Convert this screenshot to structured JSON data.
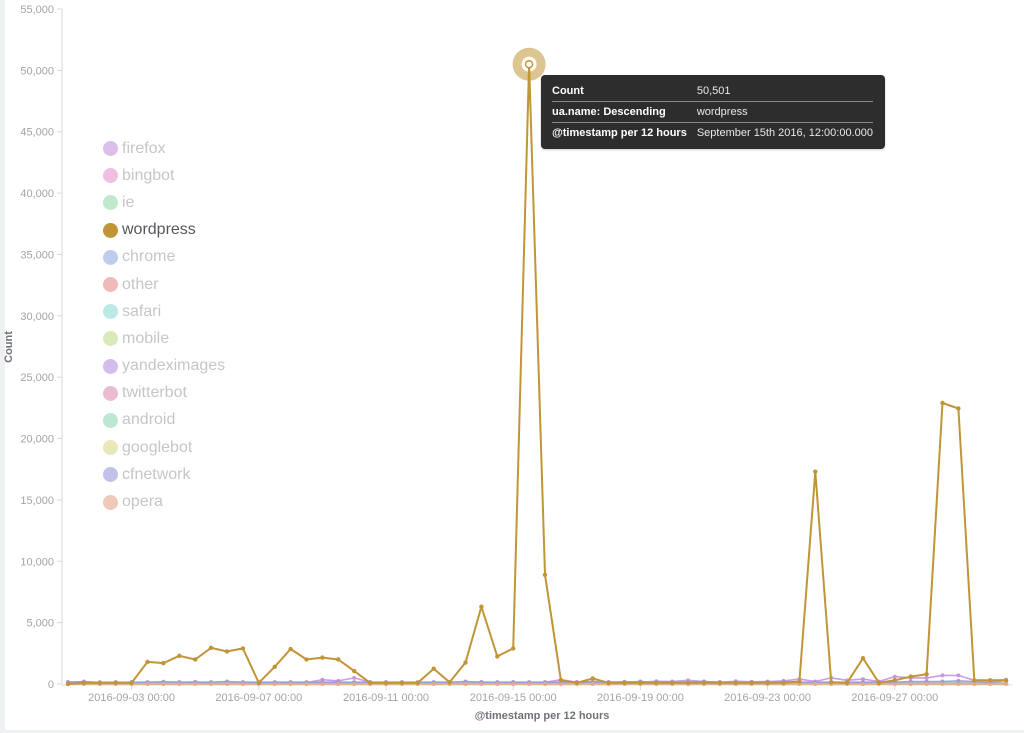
{
  "chart_data": {
    "type": "line",
    "title": "",
    "xlabel": "@timestamp per 12 hours",
    "ylabel": "Count",
    "ylim": [
      0,
      55000
    ],
    "y_ticks": [
      0,
      5000,
      10000,
      15000,
      20000,
      25000,
      30000,
      35000,
      40000,
      45000,
      50000,
      55000
    ],
    "y_tick_labels": [
      "0",
      "5,000",
      "10,000",
      "15,000",
      "20,000",
      "25,000",
      "30,000",
      "35,000",
      "40,000",
      "45,000",
      "50,000",
      "55,000"
    ],
    "x_start": "2016-09-01 00:00",
    "x_interval_hours": 12,
    "x_ticks": [
      "2016-09-03 00:00",
      "2016-09-07 00:00",
      "2016-09-11 00:00",
      "2016-09-15 00:00",
      "2016-09-19 00:00",
      "2016-09-23 00:00",
      "2016-09-27 00:00"
    ],
    "x_tick_indices": [
      4,
      12,
      20,
      28,
      36,
      44,
      52
    ],
    "grid": false,
    "legend_position": "left",
    "highlighted_series": "wordpress",
    "series": [
      {
        "name": "firefox",
        "color": "#c493dd",
        "values": [
          150,
          200,
          120,
          100,
          150,
          120,
          100,
          130,
          160,
          120,
          100,
          130,
          120,
          100,
          130,
          110,
          350,
          250,
          500,
          150,
          120,
          110,
          100,
          120,
          150,
          130,
          150,
          120,
          130,
          120,
          140,
          350,
          150,
          200,
          150,
          180,
          150,
          220,
          200,
          300,
          200,
          150,
          220,
          180,
          200,
          250,
          400,
          200,
          500,
          300,
          400,
          200,
          600,
          500,
          500,
          700,
          700,
          300,
          250,
          350
        ]
      },
      {
        "name": "bingbot",
        "color": "#e195d0",
        "values": [
          100,
          120,
          100,
          100,
          110,
          100,
          100,
          120,
          100,
          100,
          110,
          100,
          100,
          100,
          100,
          120,
          100,
          120,
          100,
          110,
          100,
          100,
          100,
          110,
          100,
          100,
          120,
          100,
          100,
          100,
          100,
          100,
          120,
          100,
          100,
          110,
          100,
          100,
          120,
          100,
          100,
          100,
          100,
          100,
          110,
          100,
          100,
          100,
          120,
          100,
          100,
          100,
          100,
          120,
          100,
          100,
          100,
          120,
          100,
          100
        ]
      },
      {
        "name": "ie",
        "color": "#94dba6",
        "values": [
          80,
          90,
          80,
          80,
          120,
          80,
          80,
          90,
          80,
          100,
          80,
          80,
          80,
          90,
          80,
          80,
          80,
          90,
          80,
          80,
          80,
          90,
          80,
          100,
          80,
          80,
          90,
          80,
          80,
          90,
          80,
          80,
          90,
          80,
          80,
          90,
          80,
          80,
          150,
          150,
          150,
          120,
          100,
          100,
          90,
          80,
          90,
          80,
          100,
          80,
          90,
          80,
          90,
          80,
          80,
          100,
          80,
          80,
          90,
          80
        ]
      },
      {
        "name": "wordpress",
        "color": "#c09537",
        "values": [
          0,
          100,
          100,
          100,
          100,
          1800,
          1700,
          2300,
          2000,
          2950,
          2650,
          2900,
          100,
          1400,
          2850,
          2000,
          2150,
          2000,
          1050,
          100,
          100,
          100,
          100,
          1250,
          150,
          1750,
          6300,
          2250,
          2900,
          50501,
          8900,
          300,
          100,
          450,
          100,
          100,
          100,
          100,
          100,
          100,
          100,
          100,
          100,
          100,
          100,
          100,
          200,
          17300,
          150,
          100,
          2100,
          100,
          300,
          600,
          800,
          22900,
          22450,
          300,
          300,
          300
        ]
      },
      {
        "name": "chrome",
        "color": "#95ace0",
        "values": [
          60,
          60,
          60,
          60,
          60,
          60,
          60,
          60,
          60,
          60,
          60,
          60,
          60,
          60,
          60,
          60,
          60,
          60,
          60,
          60,
          60,
          60,
          60,
          60,
          60,
          60,
          60,
          60,
          60,
          60,
          60,
          60,
          60,
          60,
          60,
          60,
          60,
          60,
          60,
          60,
          60,
          60,
          60,
          60,
          60,
          60,
          60,
          60,
          60,
          60,
          60,
          60,
          60,
          60,
          60,
          60,
          60,
          60,
          60,
          60
        ]
      },
      {
        "name": "other",
        "color": "#e38c8c",
        "values": [
          50,
          50,
          50,
          50,
          50,
          50,
          50,
          50,
          50,
          50,
          50,
          50,
          50,
          50,
          50,
          50,
          50,
          50,
          50,
          50,
          50,
          50,
          50,
          50,
          80,
          50,
          50,
          50,
          50,
          50,
          50,
          50,
          50,
          50,
          50,
          50,
          50,
          50,
          50,
          50,
          50,
          50,
          50,
          50,
          50,
          80,
          50,
          50,
          50,
          50,
          50,
          50,
          50,
          50,
          50,
          50,
          50,
          50,
          50,
          50
        ]
      },
      {
        "name": "safari",
        "color": "#8fdbd6",
        "values": [
          40,
          40,
          40,
          40,
          40,
          40,
          40,
          40,
          40,
          40,
          40,
          40,
          40,
          40,
          40,
          40,
          40,
          40,
          40,
          40,
          40,
          40,
          40,
          40,
          40,
          40,
          40,
          40,
          40,
          40,
          40,
          40,
          40,
          40,
          40,
          40,
          40,
          40,
          40,
          40,
          40,
          40,
          40,
          40,
          40,
          40,
          40,
          40,
          40,
          40,
          40,
          40,
          40,
          40,
          40,
          40,
          40,
          40,
          40,
          40
        ]
      },
      {
        "name": "mobile",
        "color": "#bfda8c",
        "values": [
          30,
          30,
          30,
          30,
          30,
          30,
          30,
          30,
          30,
          30,
          30,
          30,
          30,
          30,
          30,
          30,
          30,
          30,
          30,
          30,
          30,
          30,
          30,
          30,
          30,
          30,
          30,
          30,
          30,
          30,
          30,
          30,
          30,
          30,
          30,
          30,
          30,
          30,
          30,
          30,
          30,
          30,
          30,
          30,
          30,
          30,
          30,
          30,
          30,
          30,
          30,
          30,
          30,
          30,
          30,
          30,
          30,
          30,
          30,
          30
        ]
      },
      {
        "name": "yandeximages",
        "color": "#b890e0",
        "values": [
          20,
          20,
          20,
          20,
          20,
          20,
          20,
          20,
          20,
          20,
          20,
          20,
          20,
          20,
          20,
          20,
          20,
          20,
          20,
          20,
          20,
          20,
          20,
          20,
          20,
          20,
          20,
          20,
          20,
          20,
          20,
          20,
          20,
          20,
          20,
          20,
          20,
          20,
          20,
          20,
          20,
          20,
          20,
          20,
          20,
          20,
          20,
          20,
          20,
          20,
          20,
          20,
          20,
          20,
          20,
          20,
          20,
          20,
          20,
          20
        ]
      },
      {
        "name": "twitterbot",
        "color": "#dd8faf",
        "values": [
          20,
          20,
          20,
          20,
          20,
          20,
          20,
          20,
          20,
          20,
          20,
          20,
          20,
          20,
          20,
          20,
          20,
          20,
          20,
          20,
          20,
          20,
          20,
          20,
          20,
          20,
          20,
          20,
          20,
          20,
          20,
          20,
          20,
          20,
          20,
          20,
          20,
          20,
          20,
          20,
          20,
          20,
          20,
          20,
          20,
          20,
          20,
          20,
          20,
          20,
          20,
          20,
          20,
          20,
          20,
          20,
          20,
          20,
          20,
          20
        ]
      },
      {
        "name": "android",
        "color": "#8fd9b6",
        "values": [
          15,
          15,
          15,
          15,
          15,
          15,
          15,
          15,
          15,
          15,
          15,
          15,
          15,
          15,
          15,
          15,
          15,
          15,
          15,
          15,
          15,
          15,
          15,
          15,
          15,
          15,
          15,
          15,
          15,
          15,
          15,
          15,
          15,
          15,
          15,
          15,
          15,
          15,
          15,
          15,
          15,
          15,
          15,
          15,
          15,
          15,
          15,
          15,
          15,
          15,
          15,
          15,
          15,
          15,
          15,
          15,
          15,
          15,
          15,
          15
        ]
      },
      {
        "name": "googlebot",
        "color": "#d9d98e",
        "values": [
          10,
          10,
          10,
          10,
          10,
          10,
          10,
          10,
          10,
          10,
          10,
          10,
          10,
          10,
          10,
          10,
          10,
          10,
          10,
          10,
          10,
          10,
          10,
          10,
          10,
          10,
          10,
          10,
          10,
          10,
          10,
          10,
          10,
          10,
          10,
          10,
          10,
          10,
          10,
          10,
          10,
          10,
          10,
          10,
          10,
          10,
          10,
          10,
          10,
          10,
          10,
          10,
          10,
          10,
          10,
          10,
          10,
          10,
          10,
          10
        ]
      },
      {
        "name": "cfnetwork",
        "color": "#9898e0",
        "values": [
          150,
          150,
          140,
          150,
          140,
          150,
          180,
          150,
          150,
          150,
          200,
          150,
          150,
          150,
          150,
          150,
          150,
          150,
          150,
          150,
          150,
          150,
          150,
          150,
          150,
          200,
          150,
          150,
          150,
          150,
          150,
          150,
          150,
          150,
          150,
          150,
          200,
          150,
          150,
          150,
          200,
          150,
          150,
          150,
          150,
          200,
          150,
          150,
          150,
          150,
          150,
          150,
          150,
          200,
          200,
          200,
          250,
          200,
          100,
          300
        ]
      },
      {
        "name": "opera",
        "color": "#e3a888",
        "values": [
          10,
          10,
          10,
          10,
          10,
          10,
          10,
          10,
          10,
          10,
          10,
          10,
          10,
          10,
          10,
          10,
          10,
          10,
          10,
          10,
          10,
          10,
          10,
          10,
          10,
          10,
          10,
          10,
          10,
          10,
          10,
          10,
          10,
          10,
          10,
          10,
          10,
          10,
          10,
          10,
          10,
          10,
          10,
          10,
          10,
          10,
          10,
          10,
          10,
          10,
          10,
          10,
          10,
          10,
          10,
          10,
          10,
          10,
          10,
          10
        ]
      }
    ]
  },
  "legend": {
    "items": [
      "firefox",
      "bingbot",
      "ie",
      "wordpress",
      "chrome",
      "other",
      "safari",
      "mobile",
      "yandeximages",
      "twitterbot",
      "android",
      "googlebot",
      "cfnetwork",
      "opera"
    ]
  },
  "tooltip": {
    "rows": [
      {
        "key": "Count",
        "value": "50,501"
      },
      {
        "key": "ua.name: Descending",
        "value": "wordpress"
      },
      {
        "key": "@timestamp per 12 hours",
        "value": "September 15th 2016, 12:00:00.000"
      }
    ],
    "point_index": 29,
    "series": "wordpress"
  }
}
